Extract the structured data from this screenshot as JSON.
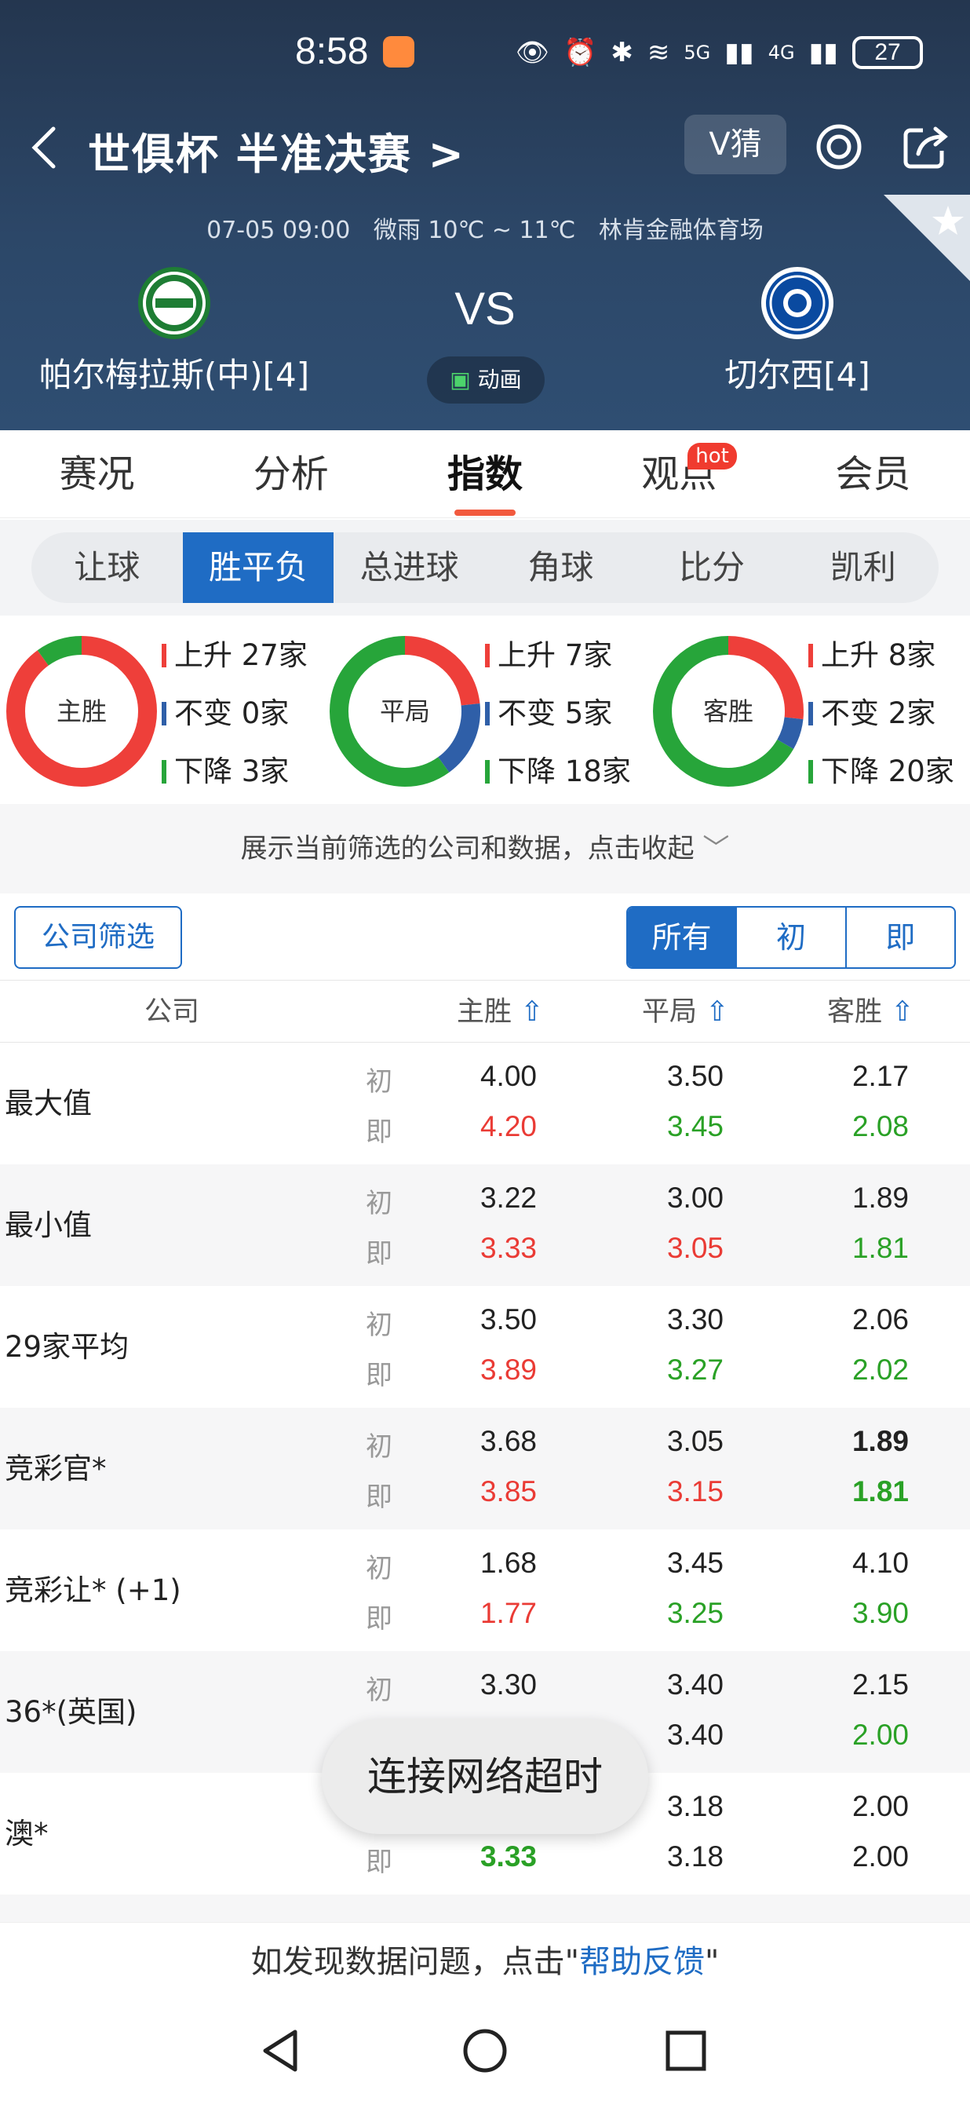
{
  "status_bar": {
    "time": "8:58",
    "network1": "5G",
    "network2": "4G",
    "battery": "27"
  },
  "header": {
    "title": "世俱杯 半准决赛 >",
    "vguess_label": "V猜",
    "meta": {
      "datetime": "07-05 09:00",
      "weather": "微雨 10℃ ~ 11℃",
      "venue": "林肯金融体育场"
    },
    "home_team": "帕尔梅拉斯(中)[4]",
    "away_team": "切尔西[4]",
    "vs": "VS",
    "animation_label": "动画"
  },
  "main_tabs": [
    "赛况",
    "分析",
    "指数",
    "观点",
    "会员"
  ],
  "main_tab_active": "指数",
  "hot_badge": "hot",
  "sub_tabs": [
    "让球",
    "胜平负",
    "总进球",
    "角球",
    "比分",
    "凯利"
  ],
  "sub_tab_active": "胜平负",
  "donuts": [
    {
      "label": "主胜",
      "up": "上升 27家",
      "same": "不变 0家",
      "down": "下降 3家",
      "up_n": 27,
      "same_n": 0,
      "down_n": 3
    },
    {
      "label": "平局",
      "up": "上升 7家",
      "same": "不变 5家",
      "down": "下降 18家",
      "up_n": 7,
      "same_n": 5,
      "down_n": 18
    },
    {
      "label": "客胜",
      "up": "上升 8家",
      "same": "不变 2家",
      "down": "下降 20家",
      "up_n": 8,
      "same_n": 2,
      "down_n": 20
    }
  ],
  "colors": {
    "up": "#ee3f3a",
    "same": "#2f5fa8",
    "down": "#27a53a",
    "accent": "#1f6cc4"
  },
  "notice": "展示当前筛选的公司和数据，点击收起",
  "company_filter": "公司筛选",
  "segments": [
    "所有",
    "初",
    "即"
  ],
  "segment_active": "所有",
  "table_headers": {
    "company": "公司",
    "home": "主胜",
    "draw": "平局",
    "away": "客胜"
  },
  "row_tags": {
    "initial": "初",
    "live": "即"
  },
  "rows": [
    {
      "name": "最大值",
      "init": [
        "4.00",
        "3.50",
        "2.17"
      ],
      "live": [
        "4.20",
        "3.45",
        "2.08"
      ],
      "live_colors": [
        "red",
        "green",
        "green"
      ]
    },
    {
      "name": "最小值",
      "init": [
        "3.22",
        "3.00",
        "1.89"
      ],
      "live": [
        "3.33",
        "3.05",
        "1.81"
      ],
      "live_colors": [
        "red",
        "red",
        "green"
      ]
    },
    {
      "name": "29家平均",
      "init": [
        "3.50",
        "3.30",
        "2.06"
      ],
      "live": [
        "3.89",
        "3.27",
        "2.02"
      ],
      "live_colors": [
        "red",
        "green",
        "green"
      ]
    },
    {
      "name": "竞彩官*",
      "init": [
        "3.68",
        "3.05",
        "1.89"
      ],
      "live": [
        "3.85",
        "3.15",
        "1.81"
      ],
      "live_colors": [
        "red",
        "red",
        "green"
      ]
    },
    {
      "name": "竞彩让* (+1)",
      "init": [
        "1.68",
        "3.45",
        "4.10"
      ],
      "live": [
        "1.77",
        "3.25",
        "3.90"
      ],
      "live_colors": [
        "red",
        "green",
        "green"
      ]
    },
    {
      "name": "36*(英国)",
      "init": [
        "3.30",
        "3.40",
        "2.15"
      ],
      "live": [
        "",
        "3.40",
        "2.00"
      ],
      "live_colors": [
        "black",
        "black",
        "green"
      ]
    },
    {
      "name": "澳*",
      "init": [
        "",
        "3.18",
        "2.00"
      ],
      "live": [
        "3.33",
        "3.18",
        "2.00"
      ],
      "live_colors": [
        "green",
        "black",
        "black"
      ]
    }
  ],
  "toast": "连接网络超时",
  "feedback": {
    "prefix": "如发现数据问题，点击\"",
    "link": "帮助反馈",
    "suffix": "\""
  }
}
